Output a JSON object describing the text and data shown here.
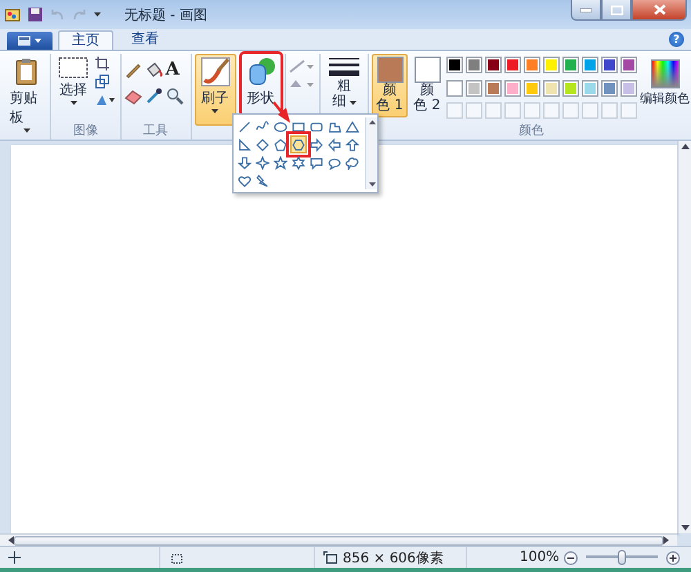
{
  "window": {
    "title": "无标题 - 画图"
  },
  "tabs": [
    {
      "label": "主页",
      "selected": true
    },
    {
      "label": "查看",
      "selected": false
    }
  ],
  "help_button": "?",
  "clipboard": {
    "label": "剪贴板"
  },
  "image": {
    "select_label": "选择",
    "group_label": "图像"
  },
  "tools": {
    "text_tool": "A",
    "group_label": "工具"
  },
  "brushes": {
    "label": "刷子",
    "selected": true
  },
  "shapes": {
    "label": "形状",
    "selected": false,
    "outline_disabled": true,
    "fill_disabled": true,
    "gallery": [
      {
        "kind": "line",
        "selected": false
      },
      {
        "kind": "curve",
        "selected": false
      },
      {
        "kind": "oval",
        "selected": false
      },
      {
        "kind": "rectangle",
        "selected": false
      },
      {
        "kind": "rounded-rectangle",
        "selected": false
      },
      {
        "kind": "polygon",
        "selected": false
      },
      {
        "kind": "triangle",
        "selected": false
      },
      {
        "kind": "right-triangle",
        "selected": false
      },
      {
        "kind": "diamond",
        "selected": false
      },
      {
        "kind": "pentagon",
        "selected": false
      },
      {
        "kind": "hexagon",
        "selected": true
      },
      {
        "kind": "right-arrow",
        "selected": false
      },
      {
        "kind": "left-arrow",
        "selected": false
      },
      {
        "kind": "up-arrow",
        "selected": false
      },
      {
        "kind": "down-arrow",
        "selected": false
      },
      {
        "kind": "star4",
        "selected": false
      },
      {
        "kind": "star5",
        "selected": false
      },
      {
        "kind": "star6",
        "selected": false
      },
      {
        "kind": "callout-rect",
        "selected": false
      },
      {
        "kind": "callout-oval",
        "selected": false
      },
      {
        "kind": "callout-cloud",
        "selected": false
      },
      {
        "kind": "heart",
        "selected": false
      },
      {
        "kind": "lightning",
        "selected": false
      }
    ]
  },
  "size": {
    "label_lines": [
      "粗",
      "细"
    ]
  },
  "colors": {
    "group_label": "颜色",
    "edit_label": "编辑颜色",
    "color1": {
      "label_lines": [
        "颜",
        "色 1"
      ],
      "color": "#b97a57",
      "selected": true
    },
    "color2": {
      "label_lines": [
        "颜",
        "色 2"
      ],
      "color": "#ffffff",
      "selected": false
    },
    "palette": [
      {
        "kind": "swatch",
        "color": "#000000"
      },
      {
        "kind": "swatch",
        "color": "#7f7f7f"
      },
      {
        "kind": "swatch",
        "color": "#880015"
      },
      {
        "kind": "swatch",
        "color": "#ed1c24"
      },
      {
        "kind": "swatch",
        "color": "#ff7f27"
      },
      {
        "kind": "swatch",
        "color": "#fff200"
      },
      {
        "kind": "swatch",
        "color": "#22b14c"
      },
      {
        "kind": "swatch",
        "color": "#00a2e8"
      },
      {
        "kind": "swatch",
        "color": "#3f48cc"
      },
      {
        "kind": "swatch",
        "color": "#a349a4"
      },
      {
        "kind": "swatch",
        "color": "#ffffff"
      },
      {
        "kind": "swatch",
        "color": "#c3c3c3"
      },
      {
        "kind": "swatch",
        "color": "#b97a57"
      },
      {
        "kind": "swatch",
        "color": "#ffaec9"
      },
      {
        "kind": "swatch",
        "color": "#ffc90e"
      },
      {
        "kind": "swatch",
        "color": "#efe4b0"
      },
      {
        "kind": "swatch",
        "color": "#b5e61d"
      },
      {
        "kind": "swatch",
        "color": "#99d9ea"
      },
      {
        "kind": "swatch",
        "color": "#7092be"
      },
      {
        "kind": "swatch",
        "color": "#c8bfe7"
      },
      {
        "kind": "empty"
      },
      {
        "kind": "empty"
      },
      {
        "kind": "empty"
      },
      {
        "kind": "empty"
      },
      {
        "kind": "empty"
      },
      {
        "kind": "empty"
      },
      {
        "kind": "empty"
      },
      {
        "kind": "empty"
      },
      {
        "kind": "empty"
      },
      {
        "kind": "empty"
      }
    ]
  },
  "status_bar": {
    "image_size": "856 × 606像素",
    "zoom": "100%",
    "zoom_slider": {
      "level": 0.5
    }
  }
}
